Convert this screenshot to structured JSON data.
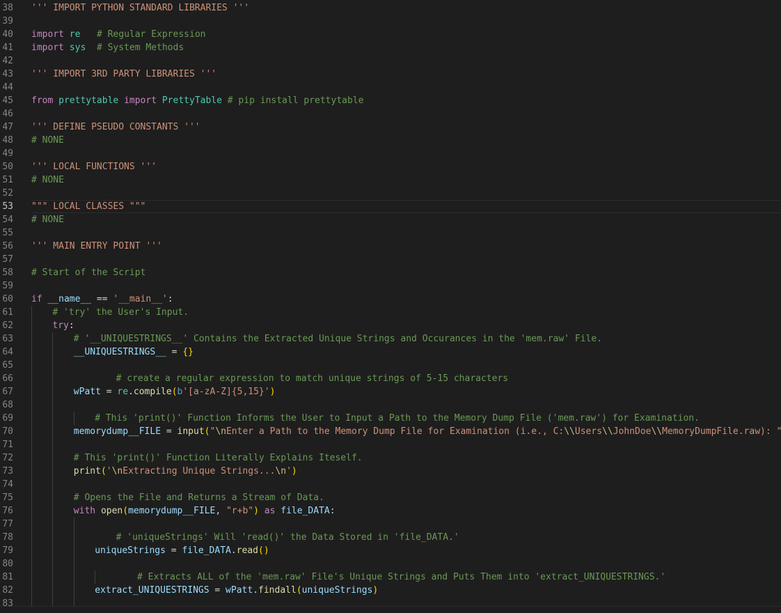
{
  "editor": {
    "active_line": 53,
    "lines": [
      {
        "n": "38",
        "indent": 0,
        "tokens": [
          [
            "st",
            "''' IMPORT PYTHON STANDARD LIBRARIES '''"
          ]
        ]
      },
      {
        "n": "39",
        "indent": 0,
        "tokens": []
      },
      {
        "n": "40",
        "indent": 0,
        "tokens": [
          [
            "kw",
            "import"
          ],
          [
            "pl",
            " "
          ],
          [
            "mod",
            "re"
          ],
          [
            "pl",
            "   "
          ],
          [
            "cm",
            "# Regular Expression"
          ]
        ]
      },
      {
        "n": "41",
        "indent": 0,
        "tokens": [
          [
            "kw",
            "import"
          ],
          [
            "pl",
            " "
          ],
          [
            "mod",
            "sys"
          ],
          [
            "pl",
            "  "
          ],
          [
            "cm",
            "# System Methods"
          ]
        ]
      },
      {
        "n": "42",
        "indent": 0,
        "tokens": []
      },
      {
        "n": "43",
        "indent": 0,
        "tokens": [
          [
            "st",
            "''' IMPORT 3RD PARTY LIBRARIES '''"
          ]
        ]
      },
      {
        "n": "44",
        "indent": 0,
        "tokens": []
      },
      {
        "n": "45",
        "indent": 0,
        "tokens": [
          [
            "kw",
            "from"
          ],
          [
            "pl",
            " "
          ],
          [
            "mod",
            "prettytable"
          ],
          [
            "pl",
            " "
          ],
          [
            "kw",
            "import"
          ],
          [
            "pl",
            " "
          ],
          [
            "cls",
            "PrettyTable"
          ],
          [
            "pl",
            " "
          ],
          [
            "cm",
            "# pip install prettytable"
          ]
        ]
      },
      {
        "n": "46",
        "indent": 0,
        "tokens": []
      },
      {
        "n": "47",
        "indent": 0,
        "tokens": [
          [
            "st",
            "''' DEFINE PSEUDO CONSTANTS '''"
          ]
        ]
      },
      {
        "n": "48",
        "indent": 0,
        "tokens": [
          [
            "cm",
            "# NONE"
          ]
        ]
      },
      {
        "n": "49",
        "indent": 0,
        "tokens": []
      },
      {
        "n": "50",
        "indent": 0,
        "tokens": [
          [
            "st",
            "''' LOCAL FUNCTIONS '''"
          ]
        ]
      },
      {
        "n": "51",
        "indent": 0,
        "tokens": [
          [
            "cm",
            "# NONE"
          ]
        ]
      },
      {
        "n": "52",
        "indent": 0,
        "tokens": []
      },
      {
        "n": "53",
        "indent": 0,
        "tokens": [
          [
            "st",
            "\"\"\" LOCAL CLASSES \"\"\""
          ]
        ]
      },
      {
        "n": "54",
        "indent": 0,
        "tokens": [
          [
            "cm",
            "# NONE"
          ]
        ]
      },
      {
        "n": "55",
        "indent": 0,
        "tokens": []
      },
      {
        "n": "56",
        "indent": 0,
        "tokens": [
          [
            "st",
            "''' MAIN ENTRY POINT '''"
          ]
        ]
      },
      {
        "n": "57",
        "indent": 0,
        "tokens": []
      },
      {
        "n": "58",
        "indent": 0,
        "tokens": [
          [
            "cm",
            "# Start of the Script"
          ]
        ]
      },
      {
        "n": "59",
        "indent": 0,
        "tokens": []
      },
      {
        "n": "60",
        "indent": 0,
        "tokens": [
          [
            "kw",
            "if"
          ],
          [
            "pl",
            " "
          ],
          [
            "vr",
            "__name__"
          ],
          [
            "op",
            " == "
          ],
          [
            "st",
            "'__main__'"
          ],
          [
            "pl",
            ":"
          ]
        ]
      },
      {
        "n": "61",
        "indent": 4,
        "tokens": [
          [
            "cm",
            "# 'try' the User's Input."
          ]
        ]
      },
      {
        "n": "62",
        "indent": 4,
        "tokens": [
          [
            "kw",
            "try"
          ],
          [
            "pl",
            ":"
          ]
        ]
      },
      {
        "n": "63",
        "indent": 8,
        "tokens": [
          [
            "cm",
            "# '__UNIQUESTRINGS__' Contains the Extracted Unique Strings and Occurances in the 'mem.raw' File."
          ]
        ]
      },
      {
        "n": "64",
        "indent": 8,
        "tokens": [
          [
            "vr",
            "__UNIQUESTRINGS__"
          ],
          [
            "op",
            " = "
          ],
          [
            "br1",
            "{}"
          ]
        ]
      },
      {
        "n": "65",
        "indent": 0,
        "tokens": []
      },
      {
        "n": "66",
        "indent": 16,
        "tokens": [
          [
            "cm",
            "# create a regular expression to match unique strings of 5-15 characters"
          ]
        ]
      },
      {
        "n": "67",
        "indent": 8,
        "tokens": [
          [
            "vr",
            "wPatt"
          ],
          [
            "op",
            " = "
          ],
          [
            "mod",
            "re"
          ],
          [
            "pl",
            "."
          ],
          [
            "fn",
            "compile"
          ],
          [
            "br1",
            "("
          ],
          [
            "bt",
            "b"
          ],
          [
            "st",
            "'[a-zA-Z]{5,15}'"
          ],
          [
            "br1",
            ")"
          ]
        ]
      },
      {
        "n": "68",
        "indent": 0,
        "tokens": []
      },
      {
        "n": "69",
        "indent": 12,
        "tokens": [
          [
            "cm",
            "# This 'print()' Function Informs the User to Input a Path to the Memory Dump File ('mem.raw') for Examination."
          ]
        ]
      },
      {
        "n": "70",
        "indent": 8,
        "tokens": [
          [
            "vr",
            "memorydump__FILE"
          ],
          [
            "op",
            " = "
          ],
          [
            "fn",
            "input"
          ],
          [
            "br1",
            "("
          ],
          [
            "st",
            "\""
          ],
          [
            "esc",
            "\\n"
          ],
          [
            "st",
            "Enter a Path to the Memory Dump File for Examination (i.e., C:"
          ],
          [
            "esc",
            "\\\\"
          ],
          [
            "st",
            "Users"
          ],
          [
            "esc",
            "\\\\"
          ],
          [
            "st",
            "JohnDoe"
          ],
          [
            "esc",
            "\\\\"
          ],
          [
            "st",
            "MemoryDumpFile.raw): \""
          ],
          [
            "br1",
            ")"
          ]
        ]
      },
      {
        "n": "71",
        "indent": 0,
        "tokens": []
      },
      {
        "n": "72",
        "indent": 8,
        "tokens": [
          [
            "cm",
            "# This 'print()' Function Literally Explains Iteself."
          ]
        ]
      },
      {
        "n": "73",
        "indent": 8,
        "tokens": [
          [
            "fn",
            "print"
          ],
          [
            "br1",
            "("
          ],
          [
            "st",
            "'"
          ],
          [
            "esc",
            "\\n"
          ],
          [
            "st",
            "Extracting Unique Strings..."
          ],
          [
            "esc",
            "\\n"
          ],
          [
            "st",
            "'"
          ],
          [
            "br1",
            ")"
          ]
        ]
      },
      {
        "n": "74",
        "indent": 0,
        "tokens": []
      },
      {
        "n": "75",
        "indent": 8,
        "tokens": [
          [
            "cm",
            "# Opens the File and Returns a Stream of Data."
          ]
        ]
      },
      {
        "n": "76",
        "indent": 8,
        "tokens": [
          [
            "kw",
            "with"
          ],
          [
            "pl",
            " "
          ],
          [
            "fn",
            "open"
          ],
          [
            "br1",
            "("
          ],
          [
            "vr",
            "memorydump__FILE"
          ],
          [
            "pl",
            ", "
          ],
          [
            "st",
            "\"r+b\""
          ],
          [
            "br1",
            ")"
          ],
          [
            "pl",
            " "
          ],
          [
            "kw",
            "as"
          ],
          [
            "pl",
            " "
          ],
          [
            "vr",
            "file_DATA"
          ],
          [
            "pl",
            ":"
          ]
        ]
      },
      {
        "n": "77",
        "indent": 0,
        "tokens": []
      },
      {
        "n": "78",
        "indent": 16,
        "tokens": [
          [
            "cm",
            "# 'uniqueStrings' Will 'read()' the Data Stored in 'file_DATA.'"
          ]
        ]
      },
      {
        "n": "79",
        "indent": 12,
        "tokens": [
          [
            "vr",
            "uniqueStrings"
          ],
          [
            "op",
            " = "
          ],
          [
            "vr",
            "file_DATA"
          ],
          [
            "pl",
            "."
          ],
          [
            "fn",
            "read"
          ],
          [
            "br1",
            "()"
          ]
        ]
      },
      {
        "n": "80",
        "indent": 0,
        "tokens": []
      },
      {
        "n": "81",
        "indent": 20,
        "tokens": [
          [
            "cm",
            "# Extracts ALL of the 'mem.raw' File's Unique Strings and Puts Them into 'extract_UNIQUESTRINGS.'"
          ]
        ]
      },
      {
        "n": "82",
        "indent": 12,
        "tokens": [
          [
            "vr",
            "extract_UNIQUESTRINGS"
          ],
          [
            "op",
            " = "
          ],
          [
            "vr",
            "wPatt"
          ],
          [
            "pl",
            "."
          ],
          [
            "fn",
            "findall"
          ],
          [
            "br1",
            "("
          ],
          [
            "vr",
            "uniqueStrings"
          ],
          [
            "br1",
            ")"
          ]
        ]
      },
      {
        "n": "83",
        "indent": 0,
        "tokens": []
      }
    ],
    "colors": {
      "background": "#1e1e1e",
      "keyword": "#c586c0",
      "module": "#4ec9b0",
      "comment": "#6a9955",
      "string": "#ce9178",
      "variable": "#9cdcfe",
      "function": "#dcdcaa",
      "bracket": "#ffd700"
    }
  }
}
